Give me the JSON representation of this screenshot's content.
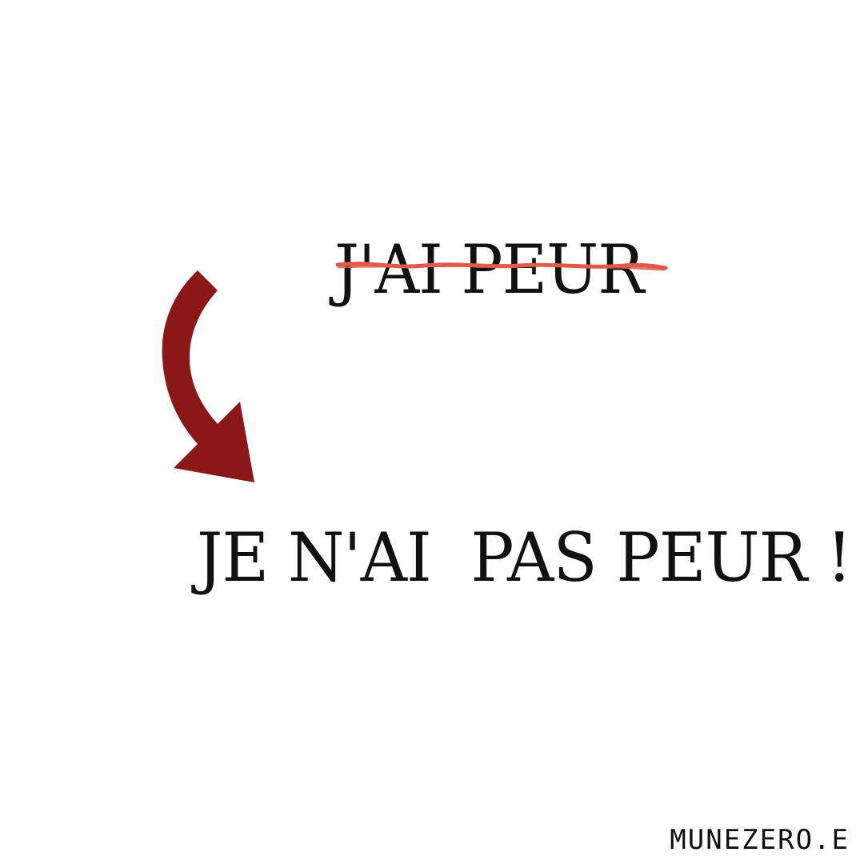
{
  "crossed_phrase": "J'AI PEUR",
  "main_phrase": "JE N'AI  PAS PEUR !",
  "signature": "MUNEZERO.E",
  "colors": {
    "background": "#ffffff",
    "text": "#111111",
    "strike": "#e05a4a",
    "arrow": "#8b1818"
  },
  "icons": {
    "arrow": "curved-arrow-down-right-icon",
    "strike": "strikethrough-scribble"
  }
}
